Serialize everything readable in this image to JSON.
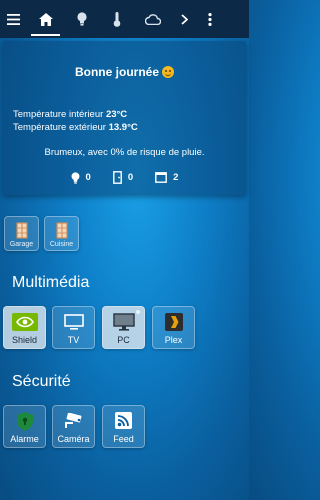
{
  "nav": {
    "icons": [
      "menu-icon",
      "home-icon",
      "lightbulb-icon",
      "thermometer-icon",
      "cloud-icon",
      "chevron-right-icon",
      "more-vert-icon"
    ],
    "active": "home-icon"
  },
  "welcome": {
    "greeting": "Bonne journée",
    "indoor_label": "Température intérieur",
    "indoor_value": "23°C",
    "outdoor_label": "Température extérieur",
    "outdoor_value": "13.9°C",
    "weather": "Brumeux, avec 0% de risque de pluie.",
    "counters": [
      {
        "icon": "lightbulb-icon",
        "value": "0"
      },
      {
        "icon": "door-icon",
        "value": "0"
      },
      {
        "icon": "window-icon",
        "value": "2"
      }
    ]
  },
  "doors": [
    {
      "label": "Garage",
      "icon": "door-icon"
    },
    {
      "label": "Cuisine",
      "icon": "door-icon"
    }
  ],
  "multimedia": {
    "title": "Multimédia",
    "tiles": [
      {
        "label": "Shield",
        "icon": "nvidia-icon"
      },
      {
        "label": "TV",
        "icon": "tv-icon"
      },
      {
        "label": "PC",
        "icon": "monitor-icon"
      },
      {
        "label": "Plex",
        "icon": "plex-icon"
      }
    ]
  },
  "security": {
    "title": "Sécurité",
    "tiles": [
      {
        "label": "Alarme",
        "icon": "shield-icon"
      },
      {
        "label": "Caméra",
        "icon": "camera-icon"
      },
      {
        "label": "Feed",
        "icon": "rss-icon"
      }
    ]
  },
  "colors": {
    "topbar": "#0c2a47",
    "background": "#0e7fc8",
    "nvidia_green": "#76b900",
    "alarm_green": "#1c8a3a",
    "plex_orange": "#e5a00d"
  }
}
